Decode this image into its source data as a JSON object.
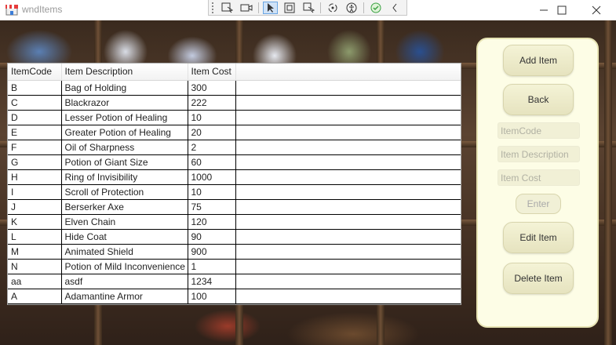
{
  "window": {
    "title": "wndItems"
  },
  "toolbar": {
    "icons": [
      "select-element-icon",
      "record-icon",
      "pointer-icon",
      "focus-rect-icon",
      "snap-icon",
      "hot-reload-icon",
      "accessibility-icon",
      "checkmark-icon",
      "collapse-icon"
    ]
  },
  "grid": {
    "columns": [
      "ItemCode",
      "Item Description",
      "Item Cost"
    ],
    "rows": [
      [
        "B",
        "Bag of Holding",
        "300"
      ],
      [
        "C",
        "Blackrazor",
        "222"
      ],
      [
        "D",
        "Lesser Potion of Healing",
        "10"
      ],
      [
        "E",
        "Greater Potion of Healing",
        "20"
      ],
      [
        "F",
        "Oil of Sharpness",
        "2"
      ],
      [
        "G",
        "Potion of Giant Size",
        "60"
      ],
      [
        "H",
        "Ring of Invisibility",
        "1000"
      ],
      [
        "I",
        "Scroll of Protection",
        "10"
      ],
      [
        "J",
        "Berserker Axe",
        "75"
      ],
      [
        "K",
        "Elven Chain",
        "120"
      ],
      [
        "L",
        "Hide Coat",
        "90"
      ],
      [
        "M",
        "Animated Shield",
        "900"
      ],
      [
        "N",
        "Potion of Mild Inconvenience",
        "1"
      ],
      [
        "aa",
        "asdf",
        "1234"
      ],
      [
        "A",
        "Adamantine Armor",
        "100"
      ]
    ]
  },
  "panel": {
    "add_label": "Add Item",
    "back_label": "Back",
    "code_placeholder": "ItemCode",
    "desc_placeholder": "Item Description",
    "cost_placeholder": "Item Cost",
    "enter_label": "Enter",
    "edit_label": "Edit Item",
    "delete_label": "Delete Item"
  }
}
